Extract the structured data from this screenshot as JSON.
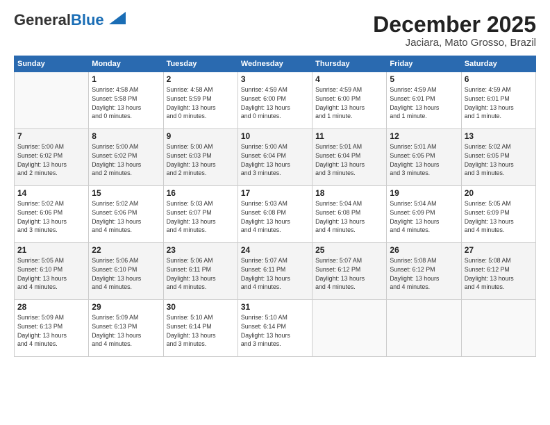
{
  "header": {
    "logo_line1": "General",
    "logo_line2": "Blue",
    "title": "December 2025",
    "subtitle": "Jaciara, Mato Grosso, Brazil"
  },
  "days": [
    "Sunday",
    "Monday",
    "Tuesday",
    "Wednesday",
    "Thursday",
    "Friday",
    "Saturday"
  ],
  "weeks": [
    [
      {
        "date": "",
        "info": ""
      },
      {
        "date": "1",
        "info": "Sunrise: 4:58 AM\nSunset: 5:58 PM\nDaylight: 13 hours\nand 0 minutes."
      },
      {
        "date": "2",
        "info": "Sunrise: 4:58 AM\nSunset: 5:59 PM\nDaylight: 13 hours\nand 0 minutes."
      },
      {
        "date": "3",
        "info": "Sunrise: 4:59 AM\nSunset: 6:00 PM\nDaylight: 13 hours\nand 0 minutes."
      },
      {
        "date": "4",
        "info": "Sunrise: 4:59 AM\nSunset: 6:00 PM\nDaylight: 13 hours\nand 1 minute."
      },
      {
        "date": "5",
        "info": "Sunrise: 4:59 AM\nSunset: 6:01 PM\nDaylight: 13 hours\nand 1 minute."
      },
      {
        "date": "6",
        "info": "Sunrise: 4:59 AM\nSunset: 6:01 PM\nDaylight: 13 hours\nand 1 minute."
      }
    ],
    [
      {
        "date": "7",
        "info": "Sunrise: 5:00 AM\nSunset: 6:02 PM\nDaylight: 13 hours\nand 2 minutes."
      },
      {
        "date": "8",
        "info": "Sunrise: 5:00 AM\nSunset: 6:02 PM\nDaylight: 13 hours\nand 2 minutes."
      },
      {
        "date": "9",
        "info": "Sunrise: 5:00 AM\nSunset: 6:03 PM\nDaylight: 13 hours\nand 2 minutes."
      },
      {
        "date": "10",
        "info": "Sunrise: 5:00 AM\nSunset: 6:04 PM\nDaylight: 13 hours\nand 3 minutes."
      },
      {
        "date": "11",
        "info": "Sunrise: 5:01 AM\nSunset: 6:04 PM\nDaylight: 13 hours\nand 3 minutes."
      },
      {
        "date": "12",
        "info": "Sunrise: 5:01 AM\nSunset: 6:05 PM\nDaylight: 13 hours\nand 3 minutes."
      },
      {
        "date": "13",
        "info": "Sunrise: 5:02 AM\nSunset: 6:05 PM\nDaylight: 13 hours\nand 3 minutes."
      }
    ],
    [
      {
        "date": "14",
        "info": "Sunrise: 5:02 AM\nSunset: 6:06 PM\nDaylight: 13 hours\nand 3 minutes."
      },
      {
        "date": "15",
        "info": "Sunrise: 5:02 AM\nSunset: 6:06 PM\nDaylight: 13 hours\nand 4 minutes."
      },
      {
        "date": "16",
        "info": "Sunrise: 5:03 AM\nSunset: 6:07 PM\nDaylight: 13 hours\nand 4 minutes."
      },
      {
        "date": "17",
        "info": "Sunrise: 5:03 AM\nSunset: 6:08 PM\nDaylight: 13 hours\nand 4 minutes."
      },
      {
        "date": "18",
        "info": "Sunrise: 5:04 AM\nSunset: 6:08 PM\nDaylight: 13 hours\nand 4 minutes."
      },
      {
        "date": "19",
        "info": "Sunrise: 5:04 AM\nSunset: 6:09 PM\nDaylight: 13 hours\nand 4 minutes."
      },
      {
        "date": "20",
        "info": "Sunrise: 5:05 AM\nSunset: 6:09 PM\nDaylight: 13 hours\nand 4 minutes."
      }
    ],
    [
      {
        "date": "21",
        "info": "Sunrise: 5:05 AM\nSunset: 6:10 PM\nDaylight: 13 hours\nand 4 minutes."
      },
      {
        "date": "22",
        "info": "Sunrise: 5:06 AM\nSunset: 6:10 PM\nDaylight: 13 hours\nand 4 minutes."
      },
      {
        "date": "23",
        "info": "Sunrise: 5:06 AM\nSunset: 6:11 PM\nDaylight: 13 hours\nand 4 minutes."
      },
      {
        "date": "24",
        "info": "Sunrise: 5:07 AM\nSunset: 6:11 PM\nDaylight: 13 hours\nand 4 minutes."
      },
      {
        "date": "25",
        "info": "Sunrise: 5:07 AM\nSunset: 6:12 PM\nDaylight: 13 hours\nand 4 minutes."
      },
      {
        "date": "26",
        "info": "Sunrise: 5:08 AM\nSunset: 6:12 PM\nDaylight: 13 hours\nand 4 minutes."
      },
      {
        "date": "27",
        "info": "Sunrise: 5:08 AM\nSunset: 6:12 PM\nDaylight: 13 hours\nand 4 minutes."
      }
    ],
    [
      {
        "date": "28",
        "info": "Sunrise: 5:09 AM\nSunset: 6:13 PM\nDaylight: 13 hours\nand 4 minutes."
      },
      {
        "date": "29",
        "info": "Sunrise: 5:09 AM\nSunset: 6:13 PM\nDaylight: 13 hours\nand 4 minutes."
      },
      {
        "date": "30",
        "info": "Sunrise: 5:10 AM\nSunset: 6:14 PM\nDaylight: 13 hours\nand 3 minutes."
      },
      {
        "date": "31",
        "info": "Sunrise: 5:10 AM\nSunset: 6:14 PM\nDaylight: 13 hours\nand 3 minutes."
      },
      {
        "date": "",
        "info": ""
      },
      {
        "date": "",
        "info": ""
      },
      {
        "date": "",
        "info": ""
      }
    ]
  ]
}
